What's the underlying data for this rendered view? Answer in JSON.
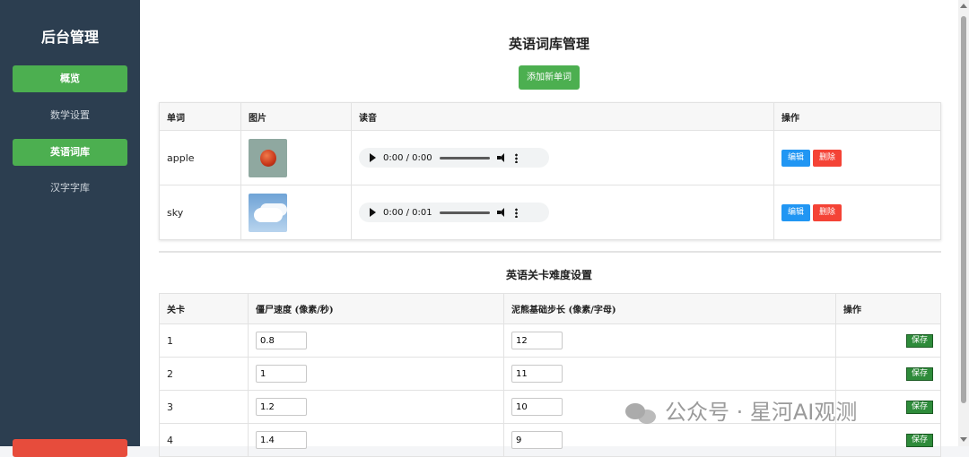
{
  "sidebar": {
    "title": "后台管理",
    "items": [
      {
        "label": "概览",
        "active": true
      },
      {
        "label": "数学设置",
        "active": false
      },
      {
        "label": "英语词库",
        "active": true
      },
      {
        "label": "汉字字库",
        "active": false
      }
    ]
  },
  "words": {
    "title": "英语词库管理",
    "add_button": "添加新单词",
    "headers": [
      "单词",
      "图片",
      "读音",
      "操作"
    ],
    "rows": [
      {
        "word": "apple",
        "image": "apple-image",
        "audio_time": "0:00 / 0:00"
      },
      {
        "word": "sky",
        "image": "sky-image",
        "audio_time": "0:00 / 0:01"
      }
    ],
    "edit_label": "编辑",
    "delete_label": "删除"
  },
  "levels": {
    "title": "英语关卡难度设置",
    "headers": [
      "关卡",
      "僵尸速度 (像素/秒)",
      "泥熊基础步长 (像素/字母)",
      "操作"
    ],
    "rows": [
      {
        "level": "1",
        "speed": "0.8",
        "step": "12"
      },
      {
        "level": "2",
        "speed": "1",
        "step": "11"
      },
      {
        "level": "3",
        "speed": "1.2",
        "step": "10"
      },
      {
        "level": "4",
        "speed": "1.4",
        "step": "9"
      }
    ],
    "save_label": "保存"
  },
  "watermark": "公众号 · 星河AI观测"
}
